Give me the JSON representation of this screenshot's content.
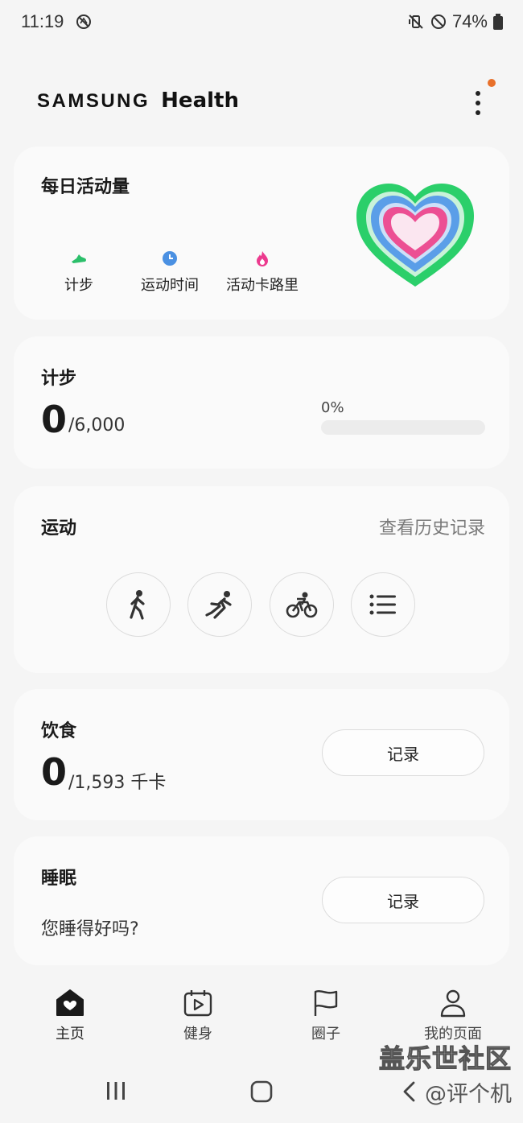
{
  "status_bar": {
    "time": "11:19",
    "battery": "74%",
    "left_icon": "no-wifi-sync-icon",
    "right_icons": [
      "mute-vibrate-icon",
      "do-not-disturb-icon",
      "battery-icon"
    ]
  },
  "header": {
    "brand_samsung": "SAMSUNG",
    "brand_health": "Health",
    "more_icon": "more-vertical-icon",
    "notification_dot_color": "#e8702a"
  },
  "activity": {
    "title": "每日活动量",
    "metrics": [
      {
        "label": "计步",
        "icon": "shoe-icon",
        "color": "#2bbf6a"
      },
      {
        "label": "运动时间",
        "icon": "clock-icon",
        "color": "#4a90e2"
      },
      {
        "label": "活动卡路里",
        "icon": "flame-icon",
        "color": "#ec3a8e"
      }
    ],
    "ring_colors": [
      "#2bcf6a",
      "#5a9ee8",
      "#ec4f93"
    ]
  },
  "steps": {
    "title": "计步",
    "value": "0",
    "goal": "/6,000",
    "percent_text": "0%",
    "progress": 0
  },
  "exercise": {
    "title": "运动",
    "history_link": "查看历史记录",
    "buttons": [
      {
        "icon": "walk-icon"
      },
      {
        "icon": "run-icon"
      },
      {
        "icon": "bike-icon"
      },
      {
        "icon": "list-icon"
      }
    ]
  },
  "food": {
    "title": "饮食",
    "value": "0",
    "goal": "/1,593 千卡",
    "button_label": "记录"
  },
  "sleep": {
    "title": "睡眠",
    "question": "您睡得好吗?",
    "button_label": "记录"
  },
  "bottom_nav": [
    {
      "label": "主页",
      "icon": "home-heart-icon",
      "active": true
    },
    {
      "label": "健身",
      "icon": "fitness-play-icon",
      "active": false
    },
    {
      "label": "圈子",
      "icon": "flag-icon",
      "active": false
    },
    {
      "label": "我的页面",
      "icon": "person-icon",
      "active": false
    }
  ],
  "system_nav": {
    "icons": [
      "recent-apps-icon",
      "home-icon",
      "back-icon"
    ]
  },
  "watermark": {
    "line1": "盖乐世社区",
    "line2": "@评个机"
  }
}
